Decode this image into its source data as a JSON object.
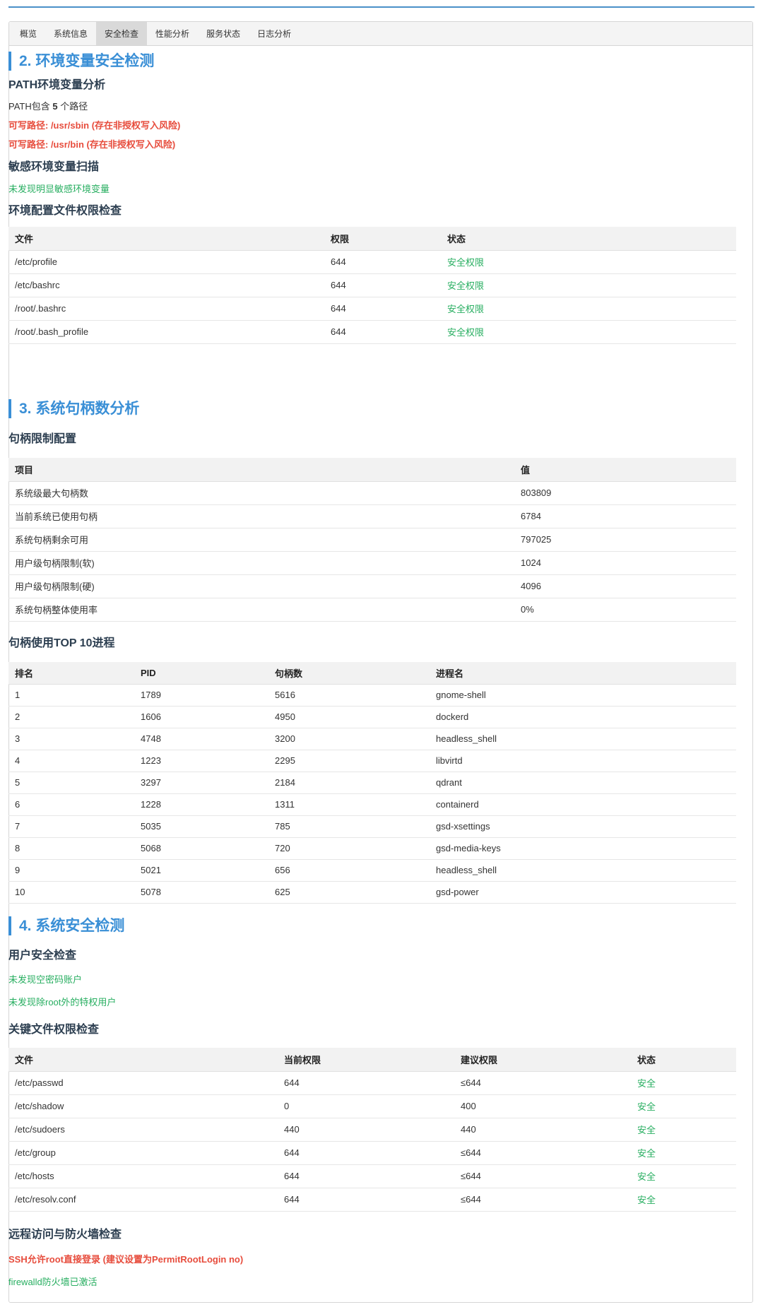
{
  "tabs": [
    {
      "label": "概览"
    },
    {
      "label": "系统信息"
    },
    {
      "label": "安全检查"
    },
    {
      "label": "性能分析"
    },
    {
      "label": "服务状态"
    },
    {
      "label": "日志分析"
    }
  ],
  "section2": {
    "title": "2. 环境变量安全检测",
    "path": {
      "title": "PATH环境变量分析",
      "count_prefix": "PATH包含 ",
      "count": "5",
      "count_suffix": " 个路径",
      "warnings": [
        "可写路径: /usr/sbin (存在非授权写入风险)",
        "可写路径: /usr/bin (存在非授权写入风险)"
      ]
    },
    "sensitive": {
      "title": "敏感环境变量扫描",
      "result": "未发现明显敏感环境变量"
    },
    "config_perm": {
      "title": "环境配置文件权限检查",
      "headers": [
        "文件",
        "权限",
        "状态"
      ],
      "rows": [
        [
          "/etc/profile",
          "644",
          "安全权限"
        ],
        [
          "/etc/bashrc",
          "644",
          "安全权限"
        ],
        [
          "/root/.bashrc",
          "644",
          "安全权限"
        ],
        [
          "/root/.bash_profile",
          "644",
          "安全权限"
        ]
      ]
    }
  },
  "section3": {
    "title": "3. 系统句柄数分析",
    "limits": {
      "title": "句柄限制配置",
      "headers": [
        "项目",
        "值"
      ],
      "rows": [
        [
          "系统级最大句柄数",
          "803809"
        ],
        [
          "当前系统已使用句柄",
          "6784"
        ],
        [
          "系统句柄剩余可用",
          "797025"
        ],
        [
          "用户级句柄限制(软)",
          "1024"
        ],
        [
          "用户级句柄限制(硬)",
          "4096"
        ],
        [
          "系统句柄整体使用率",
          "0%"
        ]
      ]
    },
    "top10": {
      "title": "句柄使用TOP 10进程",
      "headers": [
        "排名",
        "PID",
        "句柄数",
        "进程名"
      ],
      "rows": [
        [
          "1",
          "1789",
          "5616",
          "gnome-shell"
        ],
        [
          "2",
          "1606",
          "4950",
          "dockerd"
        ],
        [
          "3",
          "4748",
          "3200",
          "headless_shell"
        ],
        [
          "4",
          "1223",
          "2295",
          "libvirtd"
        ],
        [
          "5",
          "3297",
          "2184",
          "qdrant"
        ],
        [
          "6",
          "1228",
          "1311",
          "containerd"
        ],
        [
          "7",
          "5035",
          "785",
          "gsd-xsettings"
        ],
        [
          "8",
          "5068",
          "720",
          "gsd-media-keys"
        ],
        [
          "9",
          "5021",
          "656",
          "headless_shell"
        ],
        [
          "10",
          "5078",
          "625",
          "gsd-power"
        ]
      ]
    }
  },
  "section4": {
    "title": "4. 系统安全检测",
    "users": {
      "title": "用户安全检查",
      "results": [
        "未发现空密码账户",
        "未发现除root外的特权用户"
      ]
    },
    "key_files": {
      "title": "关键文件权限检查",
      "headers": [
        "文件",
        "当前权限",
        "建议权限",
        "状态"
      ],
      "rows": [
        [
          "/etc/passwd",
          "644",
          "≤644",
          "安全"
        ],
        [
          "/etc/shadow",
          "0",
          "400",
          "安全"
        ],
        [
          "/etc/sudoers",
          "440",
          "440",
          "安全"
        ],
        [
          "/etc/group",
          "644",
          "≤644",
          "安全"
        ],
        [
          "/etc/hosts",
          "644",
          "≤644",
          "安全"
        ],
        [
          "/etc/resolv.conf",
          "644",
          "≤644",
          "安全"
        ]
      ]
    },
    "remote": {
      "title": "远程访问与防火墙检查",
      "warning": "SSH允许root直接登录 (建议设置为PermitRootLogin no)",
      "ok": "firewalld防火墙已激活"
    }
  },
  "colors": {
    "accent": "#3a8fd6",
    "danger": "#e74c3c",
    "success": "#27ae60"
  }
}
